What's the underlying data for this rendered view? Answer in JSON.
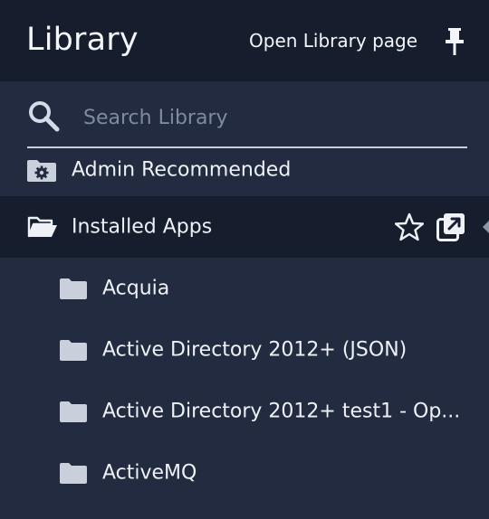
{
  "header": {
    "title": "Library",
    "open_page_link": "Open Library page",
    "pin_icon": "pin-icon"
  },
  "search": {
    "placeholder": "Search Library",
    "value": "",
    "icon": "search-icon"
  },
  "items": [
    {
      "label": "Admin Recommended",
      "icon": "gear-folder-icon"
    },
    {
      "label": "Installed Apps",
      "icon": "folder-open-icon",
      "actions": [
        "star-icon",
        "open-external-icon"
      ]
    },
    {
      "label": "Acquia",
      "icon": "folder-icon"
    },
    {
      "label": "Active Directory 2012+ (JSON)",
      "icon": "folder-icon"
    },
    {
      "label": "Active Directory 2012+ test1 - Op...",
      "icon": "folder-icon"
    },
    {
      "label": "ActiveMQ",
      "icon": "folder-icon"
    }
  ],
  "colors": {
    "header_bg": "#161d2d",
    "panel_bg": "#222b3f",
    "selected_bg": "#161d2d",
    "text": "#eef1f6",
    "placeholder": "#7f8aa0"
  }
}
